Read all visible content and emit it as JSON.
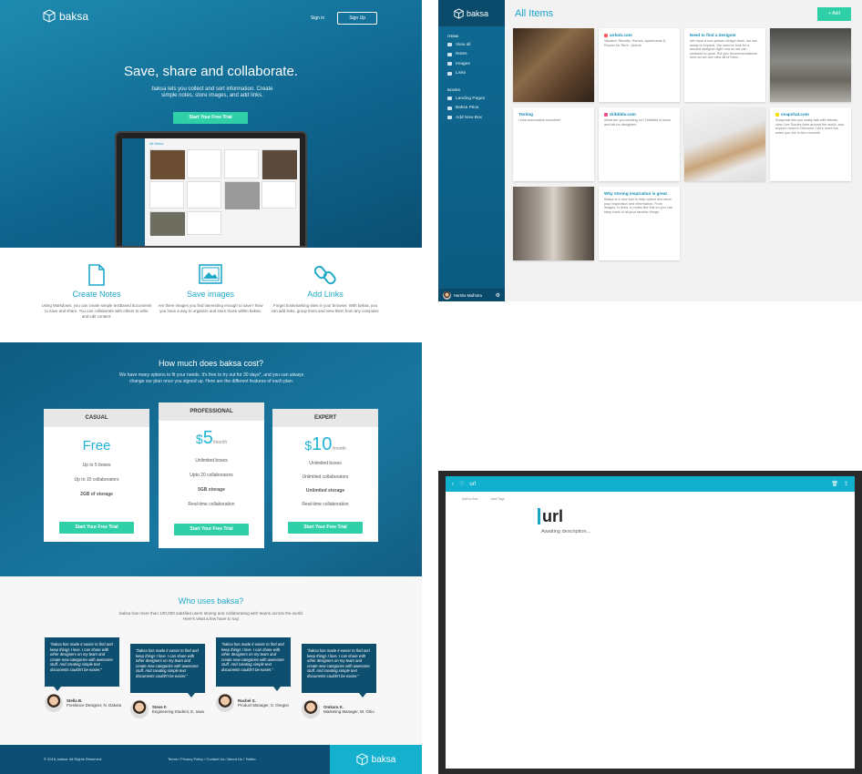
{
  "landing": {
    "brand": "baksa",
    "nav": {
      "signin": "Sign in",
      "signup": "Sign Up"
    },
    "hero": {
      "title": "Save, share and collaborate.",
      "subtitle": "baksa lets you collect and sort information. Create simple notes, store images, and add links.",
      "cta": "Start Your Free Trial"
    },
    "laptop_preview": {
      "title": "All Items"
    },
    "features": [
      {
        "icon": "document-icon",
        "title": "Create Notes",
        "text": "Using Markdown, you can create simple textbased documents to save and share. You can collaborate with others to write and edit content."
      },
      {
        "icon": "image-icon",
        "title": "Save images",
        "text": "Are there images you find interesting enough to save? Now you have a way to organize and store those within baksa."
      },
      {
        "icon": "link-icon",
        "title": "Add Links",
        "text": "Forget bookmarking sites in your browser. With baksa, you can add links, group them and view them from any computer."
      }
    ],
    "pricing": {
      "title": "How much does baksa cost?",
      "subtitle": "We have many options to fit your needs. It's free to try out for 30 days*, and you can always change  our plan once you signed up.  Here are the different   features of each plan:",
      "plans": [
        {
          "name": "CASUAL",
          "price": "Free",
          "features": [
            "Up to 5 boxes",
            "Up to 10 collaborators",
            "2GB of storage"
          ],
          "cta": "Start Your Free Trial"
        },
        {
          "name": "PROFESSIONAL",
          "currency": "$",
          "amount": "5",
          "per": "/month",
          "features": [
            "Unlimited boxes",
            "Upto 20 collaborators",
            "5GB storage",
            "Real-time collaboration"
          ],
          "cta": "Start Your Free Trial"
        },
        {
          "name": "EXPERT",
          "currency": "$",
          "amount": "10",
          "per": "/month",
          "features": [
            "Unlimited boxes",
            "Unlimited collaborators",
            "Unlimited storage",
            "Real-time collaboration"
          ],
          "cta": "Start Your Free Trial"
        }
      ]
    },
    "who": {
      "title": "Who uses baksa?",
      "subtitle": "baksa has more than 100,000 satisfied users storing and collaborating with teams across the world. Here's what a few have to say:",
      "quote": "\"baksa has made it easier to find and keep things I love. I can share with other designers on my team and create new categories with awesome stuff. And creating simple text documents couldn't be easier.\"",
      "people": [
        {
          "name": "Stella B.",
          "role": "Freelance Designer, N. Dakota"
        },
        {
          "name": "Steve F.",
          "role": "Engineering Student, E. Iowa"
        },
        {
          "name": "Rachel S.",
          "role": "Product Manager, S. Oregon"
        },
        {
          "name": "Omkara K.",
          "role": "Marketing Manager, W. Ohio"
        }
      ]
    },
    "footer": {
      "copyright": "© 2016, baksa. All Rights Reserved.",
      "links": "Terms / Privacy Policy / Contact Us / About Us / Twitter",
      "brand": "baksa"
    }
  },
  "app": {
    "brand": "baksa",
    "title": "All Items",
    "add_button": "+ Add",
    "sidebar": {
      "items_header": "ITEMS",
      "items": [
        "View all",
        "Notes",
        "Images",
        "Links"
      ],
      "boxes_header": "BOXES",
      "boxes": [
        "Landing Pages",
        "Baksa Ptios",
        "Add New Box"
      ],
      "user": "Harsha Malhotra"
    },
    "tiles": [
      {
        "type": "image"
      },
      {
        "type": "link",
        "title": "airbnb.com",
        "text": "Vacation Rentals, Homes, Apartments & Rooms for Rent - Airbnb",
        "color": "#ff5a5f"
      },
      {
        "type": "note",
        "title": "Need to find a designer",
        "text": "We have a one-person design team, but are ready to expand. We need to look for a second designer right now so we can continue to grow. Put you recommendations here so we can view all of them..."
      },
      {
        "type": "image"
      },
      {
        "type": "note",
        "title": "Testing",
        "text": "I love automation smoothie!"
      },
      {
        "type": "link",
        "title": "dribbble.com",
        "text": "What are you working on? Dribbble is show and tell for designers",
        "color": "#ea4c89"
      },
      {
        "type": "image"
      },
      {
        "type": "link",
        "title": "snapchat.com",
        "text": "Snapchat lets you easily talk with friends, view Live Stories from around the world, and explore news in Discover. Life's more fun when you live in the moment!",
        "color": "#f5e100"
      },
      {
        "type": "image"
      },
      {
        "type": "note",
        "title": "Why storing inspiration is great",
        "text": "Baksa is a new tool to help collect and store your inspiration and information. From images, to links, to notes like this so you can keep track of all your favorite things."
      }
    ]
  },
  "detail": {
    "crumb": "url",
    "tool_box": "Add to Box",
    "tool_tags": "Add Tags",
    "title": "url",
    "description": "Awaiting description..."
  }
}
